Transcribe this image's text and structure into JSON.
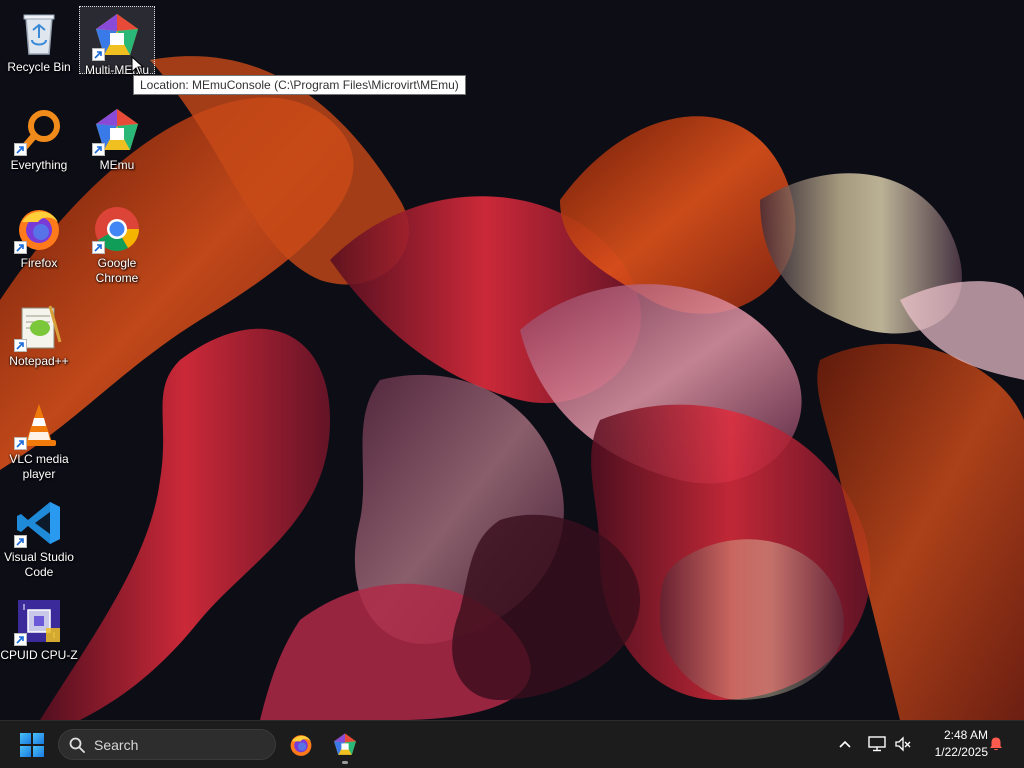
{
  "desktop": {
    "icons": [
      {
        "label": "Recycle Bin",
        "icon": "recycle-bin-icon",
        "shortcut": false
      },
      {
        "label": "Multi-MEmu",
        "icon": "memu-icon",
        "shortcut": true,
        "selected": true
      },
      {
        "label": "Everything",
        "icon": "magnifier-icon",
        "shortcut": true
      },
      {
        "label": "MEmu",
        "icon": "memu-icon",
        "shortcut": true
      },
      {
        "label": "Firefox",
        "icon": "firefox-icon",
        "shortcut": true
      },
      {
        "label": "Google Chrome",
        "icon": "chrome-icon",
        "shortcut": true
      },
      {
        "label": "Notepad++",
        "icon": "notepad-plus-plus-icon",
        "shortcut": true
      },
      {
        "label": "VLC media player",
        "icon": "vlc-cone-icon",
        "shortcut": true
      },
      {
        "label": "Visual Studio Code",
        "icon": "vscode-icon",
        "shortcut": true
      },
      {
        "label": "CPUID CPU-Z",
        "icon": "cpu-chip-icon",
        "shortcut": true
      }
    ],
    "tooltip": "Location: MEmuConsole (C:\\Program Files\\Microvirt\\MEmu)"
  },
  "taskbar": {
    "start_icon": "windows-logo-icon",
    "search_placeholder": "Search",
    "pinned": [
      {
        "name": "Firefox",
        "icon": "firefox-icon"
      },
      {
        "name": "MEmu",
        "icon": "memu-icon",
        "running": true
      }
    ],
    "tray": {
      "chevron_icon": "chevron-up-icon",
      "network_icon": "network-icon",
      "volume_icon": "volume-muted-icon",
      "time": "2:48 AM",
      "date": "1/22/2025",
      "notification_icon": "bell-icon",
      "notification_color": "#ff5a4e"
    }
  },
  "colors": {
    "taskbar_bg": "#1c1c1c",
    "wallpaper_bg": "#0d0d16",
    "accent_orange": "#e85c1c",
    "accent_red": "#d02a3a"
  }
}
